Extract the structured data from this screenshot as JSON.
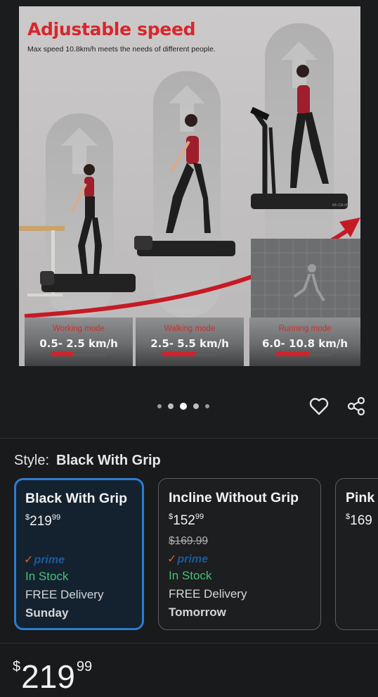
{
  "hero": {
    "title": "Adjustable speed",
    "subtitle": "Max speed 10.8km/h meets the needs of different people.",
    "modes": [
      {
        "label": "Working mode",
        "speed": "0.5- 2.5 km/h",
        "level": 0.4
      },
      {
        "label": "Walking mode",
        "speed": "2.5- 5.5 km/h",
        "level": 0.6
      },
      {
        "label": "Running mode",
        "speed": "6.0- 10.8 km/h",
        "level": 0.6
      }
    ],
    "model_tag": "RF-CR-05"
  },
  "carousel": {
    "count": 5,
    "active_index": 2
  },
  "actions": {
    "wishlist_icon": "heart-icon",
    "share_icon": "share-icon"
  },
  "style": {
    "label": "Style:",
    "selected": "Black With Grip",
    "options": [
      {
        "name": "Black With Grip",
        "currency": "$",
        "price_whole": "219",
        "price_cents": "99",
        "was": "",
        "prime": "prime",
        "stock": "In Stock",
        "delivery": "FREE Delivery",
        "when": "Sunday",
        "selected": true
      },
      {
        "name": "Incline Without Grip",
        "currency": "$",
        "price_whole": "152",
        "price_cents": "99",
        "was": "$169.99",
        "prime": "prime",
        "stock": "In Stock",
        "delivery": "FREE Delivery",
        "when": "Tomorrow",
        "selected": false
      },
      {
        "name": "Pink",
        "currency": "$",
        "price_whole": "169",
        "price_cents": "",
        "was": "",
        "prime": "",
        "stock": "",
        "delivery": "",
        "when": "",
        "selected": false
      }
    ]
  },
  "price": {
    "currency": "$",
    "whole": "219",
    "cents": "99"
  },
  "colors": {
    "accent_red": "#d8262d",
    "in_stock": "#47c07a",
    "selected_border": "#2d7bd0",
    "prime_blue": "#1a5a9e"
  }
}
